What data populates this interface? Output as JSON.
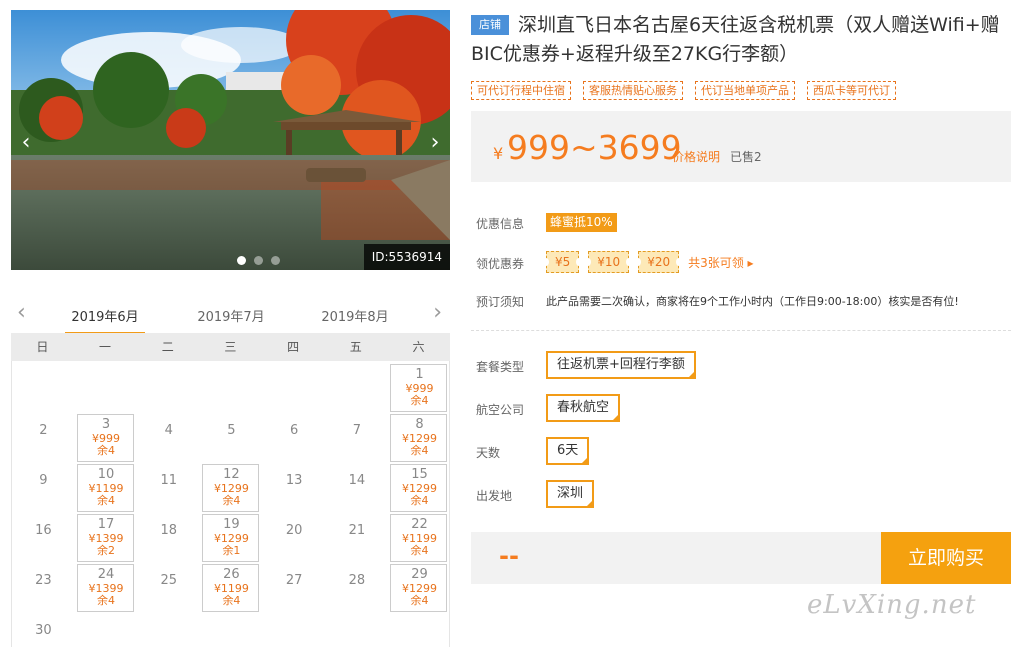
{
  "gallery": {
    "id_label": "ID:5536914",
    "prev_icon": "chevron-left-icon",
    "next_icon": "chevron-right-icon",
    "slide_count": 3,
    "active_slide": 1
  },
  "calendar": {
    "months": [
      "2019年6月",
      "2019年7月",
      "2019年8月"
    ],
    "active_month": "2019年6月",
    "weekdays": [
      "日",
      "一",
      "二",
      "三",
      "四",
      "五",
      "六"
    ],
    "days": [
      {
        "day": "1",
        "col": 6,
        "row": 0,
        "price": "¥999",
        "stock": "余4"
      },
      {
        "day": "2",
        "col": 0,
        "row": 1
      },
      {
        "day": "3",
        "col": 1,
        "row": 1,
        "price": "¥999",
        "stock": "余4"
      },
      {
        "day": "4",
        "col": 2,
        "row": 1
      },
      {
        "day": "5",
        "col": 3,
        "row": 1
      },
      {
        "day": "6",
        "col": 4,
        "row": 1
      },
      {
        "day": "7",
        "col": 5,
        "row": 1
      },
      {
        "day": "8",
        "col": 6,
        "row": 1,
        "price": "¥1299",
        "stock": "余4"
      },
      {
        "day": "9",
        "col": 0,
        "row": 2
      },
      {
        "day": "10",
        "col": 1,
        "row": 2,
        "price": "¥1199",
        "stock": "余4"
      },
      {
        "day": "11",
        "col": 2,
        "row": 2
      },
      {
        "day": "12",
        "col": 3,
        "row": 2,
        "price": "¥1299",
        "stock": "余4"
      },
      {
        "day": "13",
        "col": 4,
        "row": 2
      },
      {
        "day": "14",
        "col": 5,
        "row": 2
      },
      {
        "day": "15",
        "col": 6,
        "row": 2,
        "price": "¥1299",
        "stock": "余4"
      },
      {
        "day": "16",
        "col": 0,
        "row": 3
      },
      {
        "day": "17",
        "col": 1,
        "row": 3,
        "price": "¥1399",
        "stock": "余2"
      },
      {
        "day": "18",
        "col": 2,
        "row": 3
      },
      {
        "day": "19",
        "col": 3,
        "row": 3,
        "price": "¥1299",
        "stock": "余1"
      },
      {
        "day": "20",
        "col": 4,
        "row": 3
      },
      {
        "day": "21",
        "col": 5,
        "row": 3
      },
      {
        "day": "22",
        "col": 6,
        "row": 3,
        "price": "¥1199",
        "stock": "余4"
      },
      {
        "day": "23",
        "col": 0,
        "row": 4
      },
      {
        "day": "24",
        "col": 1,
        "row": 4,
        "price": "¥1399",
        "stock": "余4"
      },
      {
        "day": "25",
        "col": 2,
        "row": 4
      },
      {
        "day": "26",
        "col": 3,
        "row": 4,
        "price": "¥1199",
        "stock": "余4"
      },
      {
        "day": "27",
        "col": 4,
        "row": 4
      },
      {
        "day": "28",
        "col": 5,
        "row": 4
      },
      {
        "day": "29",
        "col": 6,
        "row": 4,
        "price": "¥1299",
        "stock": "余4"
      },
      {
        "day": "30",
        "col": 0,
        "row": 5
      }
    ]
  },
  "product": {
    "shop_badge": "店铺",
    "title": "深圳直飞日本名古屋6天往返含税机票（双人赠送Wifi+赠BIC优惠券+返程升级至27KG行李额）",
    "tags": [
      "可代订行程中住宿",
      "客服热情贴心服务",
      "代订当地单项产品",
      "西瓜卡等可代订"
    ],
    "price": {
      "currency": "¥",
      "range": "999~3699",
      "explain": "价格说明",
      "sold": "已售2"
    },
    "promo_label": "优惠信息",
    "promo_badge": "蜂蜜抵10%",
    "coupon_label": "领优惠券",
    "coupons": [
      "¥5",
      "¥10",
      "¥20"
    ],
    "coupon_more": "共3张可领 ▸",
    "notice_label": "预订须知",
    "notice_text": "此产品需要二次确认，商家将在9个工作小时内（工作日9:00-18:00）核实是否有位!",
    "options": {
      "package_label": "套餐类型",
      "package_value": "往返机票+回程行李额",
      "airline_label": "航空公司",
      "airline_value": "春秋航空",
      "days_label": "天数",
      "days_value": "6天",
      "departure_label": "出发地",
      "departure_value": "深圳"
    },
    "total_price": "--",
    "buy_button": "立即购买"
  },
  "watermark": "eLvXing.net",
  "colors": {
    "accent": "#f29b17",
    "price": "#f57c1f",
    "buy": "#f5a10f",
    "shop_badge": "#4a90d9"
  }
}
